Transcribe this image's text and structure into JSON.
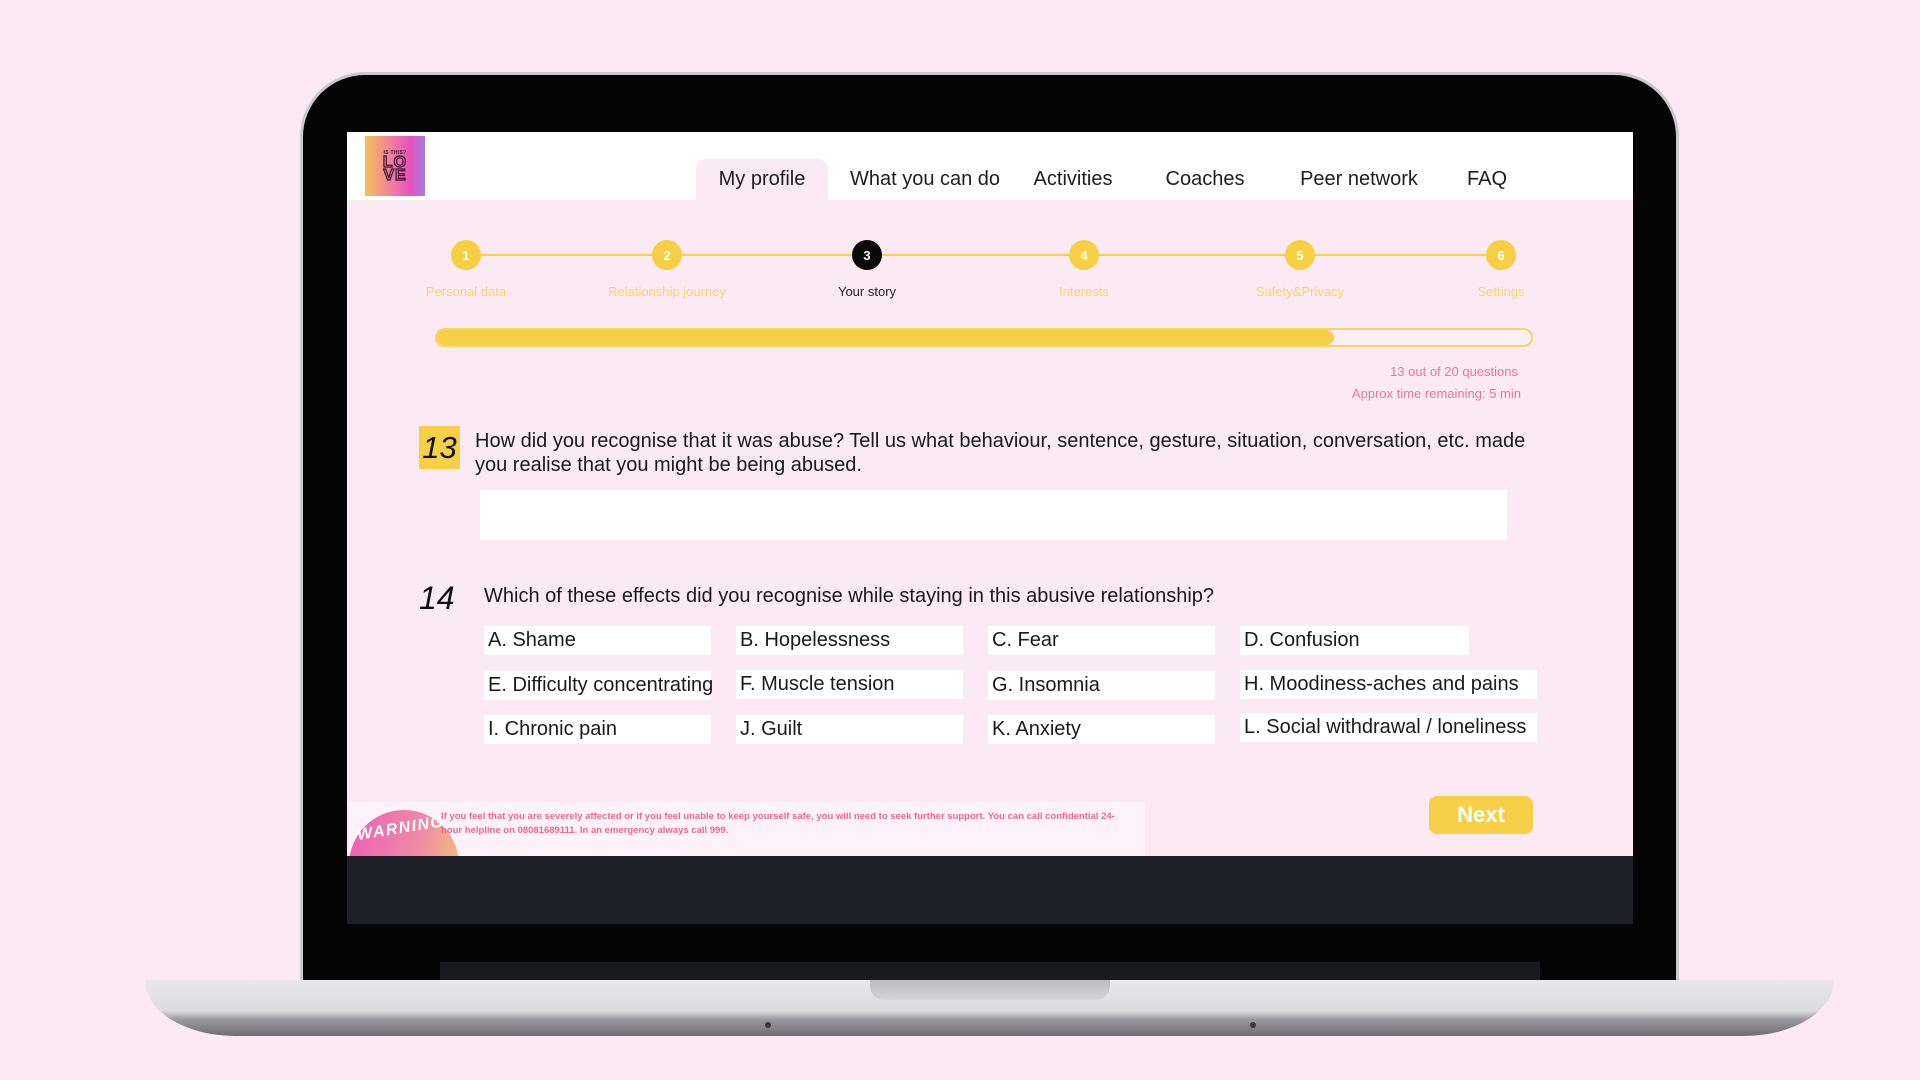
{
  "logo": {
    "tagline": "IS THIS?",
    "word_line1": "LO",
    "word_line2": "VE"
  },
  "nav": {
    "tabs": [
      {
        "label": "My profile",
        "active": true
      },
      {
        "label": "What you can do",
        "active": false
      },
      {
        "label": "Activities",
        "active": false
      },
      {
        "label": "Coaches",
        "active": false
      },
      {
        "label": "Peer network",
        "active": false
      },
      {
        "label": "FAQ",
        "active": false
      }
    ]
  },
  "stepper": {
    "current_step": 3,
    "steps": [
      {
        "number": "1",
        "label": "Personal data"
      },
      {
        "number": "2",
        "label": "Relationship journey"
      },
      {
        "number": "3",
        "label": "Your story"
      },
      {
        "number": "4",
        "label": "Interests"
      },
      {
        "number": "5",
        "label": "Safety&Privacy"
      },
      {
        "number": "6",
        "label": "Settings"
      }
    ]
  },
  "progress": {
    "fill_percent": 82,
    "questions_text": "13 out of 20 questions",
    "time_text": "Approx time remaining: 5 min"
  },
  "questions": {
    "q13": {
      "number": "13",
      "text": "How did you recognise that it was abuse? Tell us what behaviour, sentence, gesture, situation, conversation, etc. made you realise that you might be being abused.",
      "answer_value": ""
    },
    "q14": {
      "number": "14",
      "text": "Which of these effects did you recognise while staying in this abusive relationship?",
      "options": [
        "A. Shame",
        "B. Hopelessness",
        "C. Fear",
        "D. Confusion",
        "E. Difficulty concentrating",
        "F. Muscle tension",
        "G. Insomnia",
        "H. Moodiness-aches and pains",
        "I. Chronic pain",
        "J. Guilt",
        "K. Anxiety",
        "L. Social withdrawal / loneliness"
      ]
    }
  },
  "warning": {
    "badge": "WARNING",
    "text": "If you feel that you are severely affected or if you feel unable to keep yourself safe, you will need to seek further support. You can call confidential 24-hour helpline on 08081689111. In an emergency always call 999."
  },
  "actions": {
    "next_label": "Next"
  },
  "colors": {
    "accent_yellow": "#f6d047",
    "page_pink": "#fbeaf4",
    "warning_pink": "#ea6a8f",
    "current_step": "#0a0a0a"
  }
}
